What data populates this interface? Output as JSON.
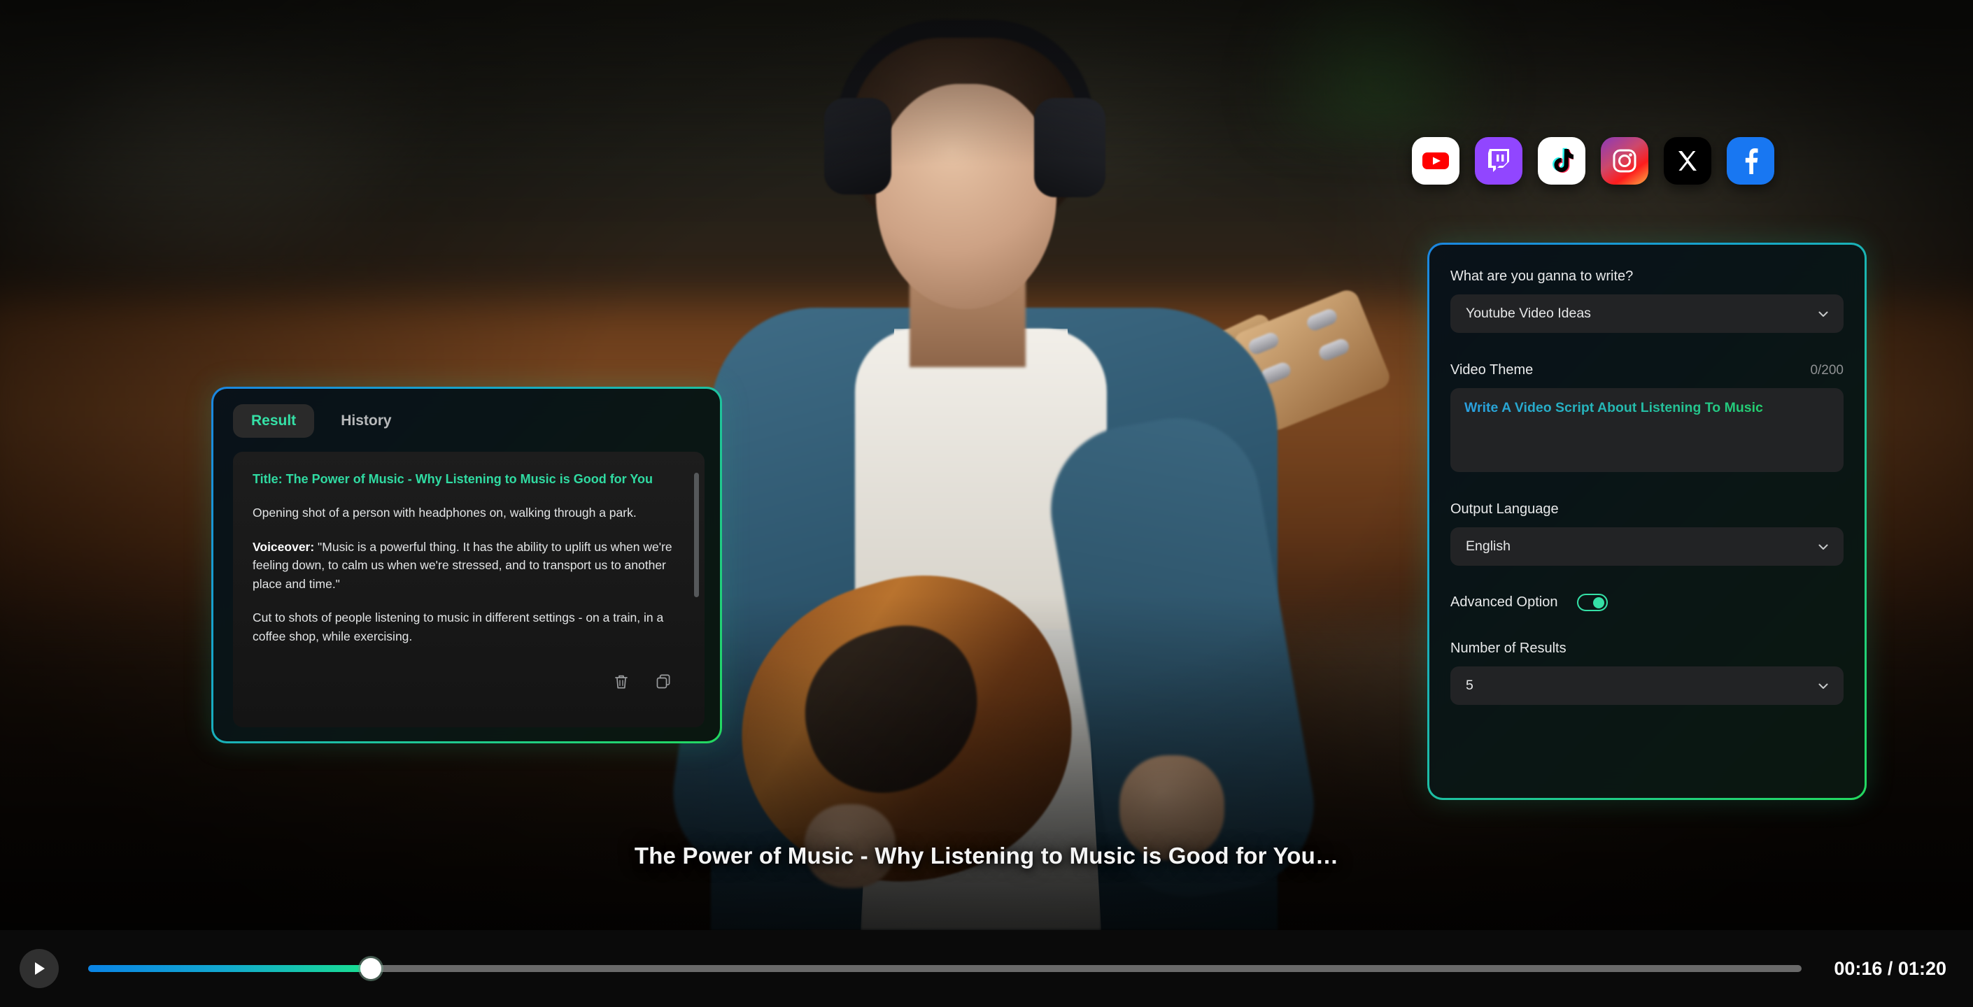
{
  "social_icons": [
    {
      "name": "youtube",
      "label": "YouTube"
    },
    {
      "name": "twitch",
      "label": "Twitch"
    },
    {
      "name": "tiktok",
      "label": "TikTok"
    },
    {
      "name": "instagram",
      "label": "Instagram"
    },
    {
      "name": "x",
      "label": "X"
    },
    {
      "name": "facebook",
      "label": "Facebook"
    }
  ],
  "result_panel": {
    "tabs": [
      {
        "label": "Result",
        "active": true
      },
      {
        "label": "History",
        "active": false
      }
    ],
    "content": {
      "title": "Title: The Power of Music - Why Listening to Music is Good for You",
      "paragraph_1": "Opening shot of a person with headphones on, walking through a park.",
      "voiceover_label": "Voiceover:",
      "voiceover_text": " \"Music is a powerful thing. It has the ability to uplift us when we're feeling down, to calm us when we're stressed, and to transport us to another place and time.\"",
      "paragraph_3": "Cut to shots of people listening to music in different settings - on a train, in a coffee shop, while exercising."
    },
    "actions": [
      {
        "name": "delete-icon",
        "label": "Delete"
      },
      {
        "name": "copy-icon",
        "label": "Copy"
      }
    ]
  },
  "form_panel": {
    "write_type": {
      "label": "What are you ganna to write?",
      "value": "Youtube Video Ideas"
    },
    "video_theme": {
      "label": "Video Theme",
      "counter": "0/200",
      "value": "Write A Video Script About Listening To Music"
    },
    "output_language": {
      "label": "Output Language",
      "value": "English"
    },
    "advanced_option": {
      "label": "Advanced Option",
      "enabled": true
    },
    "number_of_results": {
      "label": "Number of Results",
      "value": "5"
    }
  },
  "video": {
    "caption": "The Power of Music - Why Listening to Music is Good for You…",
    "current_time": "00:16",
    "total_time": "01:20",
    "time_display": "00:16 / 01:20",
    "progress_percent": 16.5,
    "playing": false
  },
  "colors": {
    "accent_green": "#35e0a6",
    "accent_blue": "#1b86e0",
    "gradient_start": "#1b86e0",
    "gradient_end": "#23d95f",
    "panel_bg": "#09090a",
    "field_bg": "#222325"
  }
}
